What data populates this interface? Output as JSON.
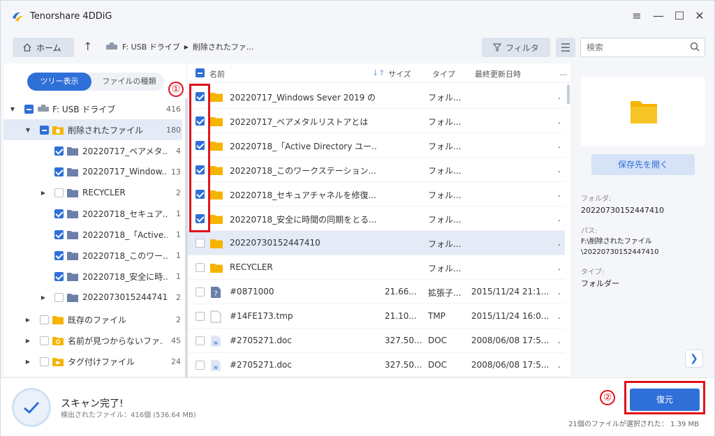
{
  "app": {
    "title": "Tenorshare 4DDiG"
  },
  "toolbar": {
    "home_label": "ホーム",
    "breadcrumb": [
      "F: USB ドライブ",
      "削除されたファ..."
    ],
    "filter_label": "フィルタ",
    "search_placeholder": "検索"
  },
  "view_tabs": [
    "ツリー表示",
    "ファイルの種類"
  ],
  "tree": [
    {
      "label": "F: USB ドライブ",
      "count": "416"
    },
    {
      "label": "削除されたファイル",
      "count": "180"
    },
    {
      "label": "20220717_ベアメタ...",
      "count": "4"
    },
    {
      "label": "20220717_Window...",
      "count": "13"
    },
    {
      "label": "RECYCLER",
      "count": "2"
    },
    {
      "label": "20220718_セキュア...",
      "count": "1"
    },
    {
      "label": "20220718_「Active...",
      "count": "1"
    },
    {
      "label": "20220718_このワー...",
      "count": "1"
    },
    {
      "label": "20220718_安全に時...",
      "count": "1"
    },
    {
      "label": "20220730152447410",
      "count": "2"
    },
    {
      "label": "既存のファイル",
      "count": "2"
    },
    {
      "label": "名前が見つからないファ...",
      "count": "45"
    },
    {
      "label": "タグ付けファイル",
      "count": "24"
    }
  ],
  "columns": {
    "name": "名前",
    "size": "サイズ",
    "type": "タイプ",
    "modified": "最終更新日時",
    "more": "..."
  },
  "files": [
    {
      "name": "20220717_Windows Sever 2019 の...",
      "size": "",
      "type": "フォル...",
      "date": "",
      "tail": "."
    },
    {
      "name": "20220717_ベアメタルリストアとは",
      "size": "",
      "type": "フォル...",
      "date": "",
      "tail": "."
    },
    {
      "name": "20220718_「Active Directory ユー...",
      "size": "",
      "type": "フォル...",
      "date": "",
      "tail": "."
    },
    {
      "name": "20220718_このワークステーション...",
      "size": "",
      "type": "フォル...",
      "date": "",
      "tail": "."
    },
    {
      "name": "20220718_セキュアチャネルを修復...",
      "size": "",
      "type": "フォル...",
      "date": "",
      "tail": "."
    },
    {
      "name": "20220718_安全に時間の同期をとる...",
      "size": "",
      "type": "フォル...",
      "date": "",
      "tail": "."
    },
    {
      "name": "20220730152447410",
      "size": "",
      "type": "フォル...",
      "date": "",
      "tail": "."
    },
    {
      "name": "RECYCLER",
      "size": "",
      "type": "フォル...",
      "date": "",
      "tail": "."
    },
    {
      "name": "#0871000",
      "size": "21.66...",
      "type": "拡張子...",
      "date": "2015/11/24 21:1...",
      "tail": "."
    },
    {
      "name": "#14FE173.tmp",
      "size": "21.10...",
      "type": "TMP",
      "date": "2015/11/24 16:0...",
      "tail": "."
    },
    {
      "name": "#2705271.doc",
      "size": "327.50...",
      "type": "DOC",
      "date": "2008/06/08 17:5...",
      "tail": "."
    },
    {
      "name": "#2705271.doc",
      "size": "327.50...",
      "type": "DOC",
      "date": "2008/06/08 17:5...",
      "tail": "."
    }
  ],
  "preview": {
    "open_button": "保存先を開く",
    "folder_label": "フォルダ:",
    "folder_value": "20220730152447410",
    "path_label": "パス:",
    "path_line1": "F:\\削除されたファイル",
    "path_line2": "\\20220730152447410",
    "type_label": "タイプ:",
    "type_value": "フォルダー"
  },
  "status": {
    "title": "スキャン完了!",
    "subtitle": "検出されたファイル：416個 (536.64 MB)",
    "recover_label": "復元",
    "selected_info": "21個のファイルが選択された： 1.39 MB"
  },
  "annotations": {
    "one": "①",
    "two": "②"
  },
  "colors": {
    "accent": "#2f6fd8",
    "folder": "#f5b400",
    "highlight": "#e0121c"
  }
}
